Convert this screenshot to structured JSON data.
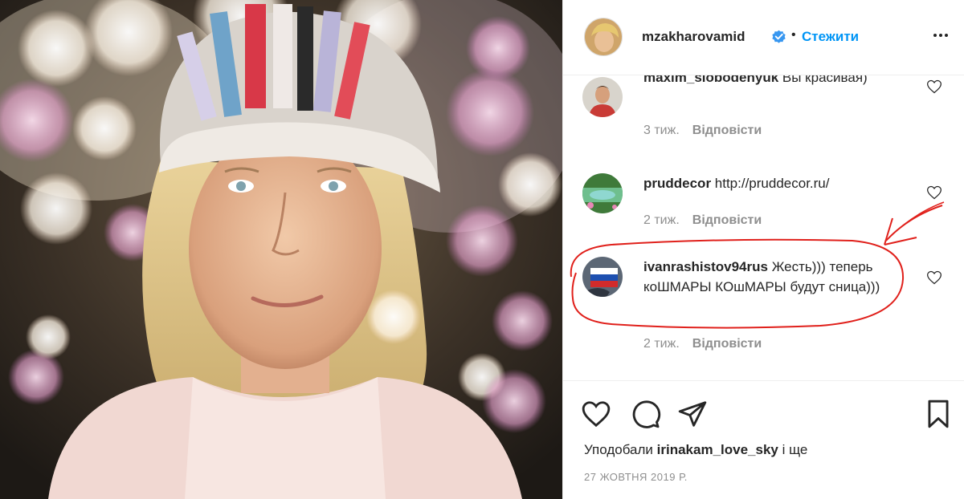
{
  "post": {
    "author": "mzakharovamid",
    "dot": "•",
    "follow_label": "Стежити",
    "more_icon": "more-icon",
    "verified_icon": "verified-badge-icon"
  },
  "comments": [
    {
      "user": "maxim_slobodenyuk",
      "text": " Вы красивая)",
      "time": "3 тиж.",
      "reply": "Відповісти"
    },
    {
      "user": "pruddecor",
      "text": " http://pruddecor.ru/",
      "time": "2 тиж.",
      "reply": "Відповісти"
    },
    {
      "user": "ivanrashistov94rus",
      "text": " Жесть))) теперь коШМАРЫ КОшМАРЫ будут сница)))",
      "time": "2 тиж.",
      "reply": "Відповісти"
    }
  ],
  "actions": {
    "like_icon": "heart-icon",
    "comment_icon": "comment-icon",
    "share_icon": "share-icon",
    "save_icon": "bookmark-icon"
  },
  "likes": {
    "prefix": "Уподобали ",
    "user": "irinakam_love_sky",
    "suffix": " і ще"
  },
  "date": "27 ЖОВТНЯ 2019 Р.",
  "colors": {
    "link": "#0095f6",
    "annotation": "#e0201b",
    "muted": "#8e8e8e"
  }
}
